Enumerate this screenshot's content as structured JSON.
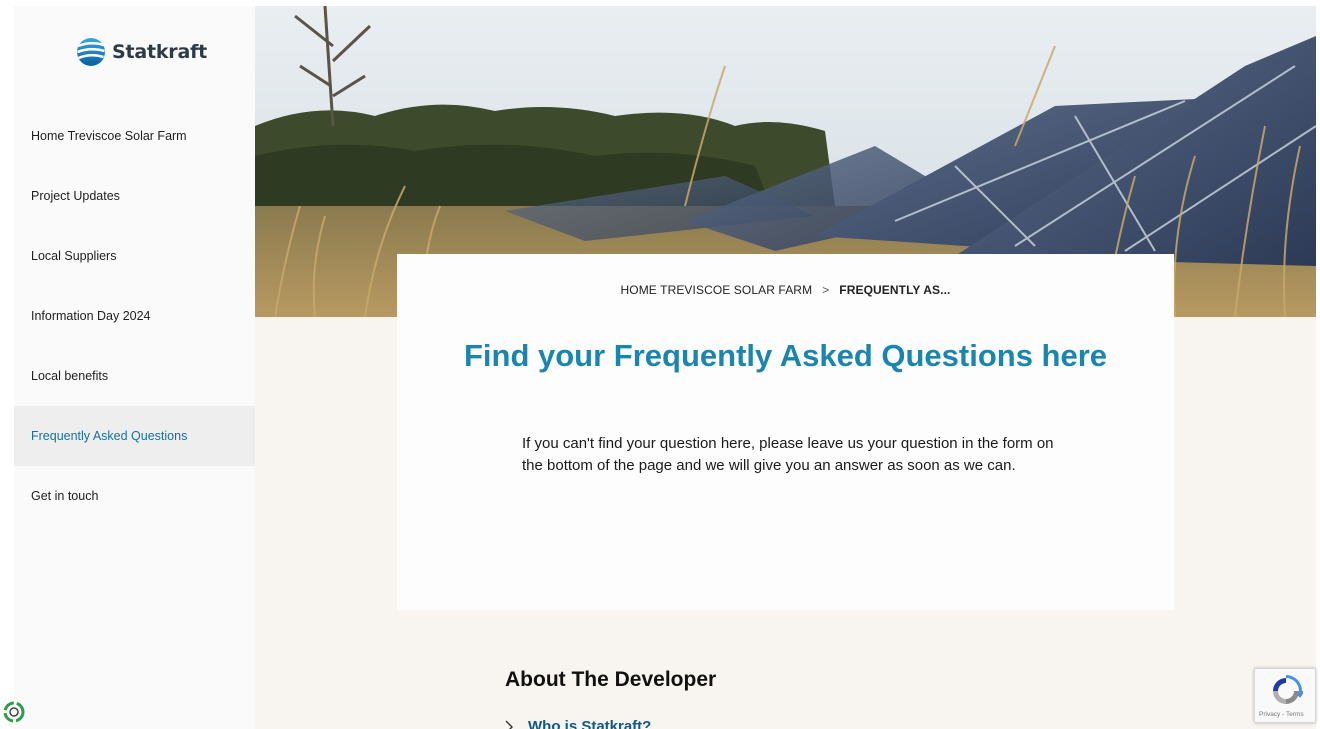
{
  "brand": {
    "name": "Statkraft"
  },
  "sidebar": {
    "items": [
      {
        "label": "Home Treviscoe Solar Farm",
        "active": false
      },
      {
        "label": "Project Updates",
        "active": false
      },
      {
        "label": "Local Suppliers",
        "active": false
      },
      {
        "label": "Information Day 2024",
        "active": false
      },
      {
        "label": "Local benefits",
        "active": false
      },
      {
        "label": "Frequently Asked Questions",
        "active": true
      },
      {
        "label": "Get in touch",
        "active": false
      }
    ]
  },
  "breadcrumb": {
    "home": "HOME TREVISCOE SOLAR FARM",
    "current": "FREQUENTLY AS..."
  },
  "main": {
    "title": "Find your Frequently Asked Questions here",
    "intro": "If you can't find your question here, please leave us your question in the form on the bottom of the page and we will give you an answer as soon as we can.",
    "about_heading": "About The Developer",
    "first_question": "Who is Statkraft?"
  },
  "recaptcha": {
    "links": "Privacy - Terms"
  },
  "colors": {
    "accent": "#1a86b0",
    "link": "#0f5a86",
    "active_nav": "#1a6f9a",
    "sidebar_bg": "#fafafa",
    "page_bg": "#f8f4ef"
  },
  "icons": {
    "logo": "statkraft-logo-icon",
    "breadcrumb_separator": "chevron-right-icon",
    "faq_toggle": "chevron-right-icon",
    "badge": "recycle-badge-icon",
    "recaptcha": "recaptcha-icon"
  }
}
